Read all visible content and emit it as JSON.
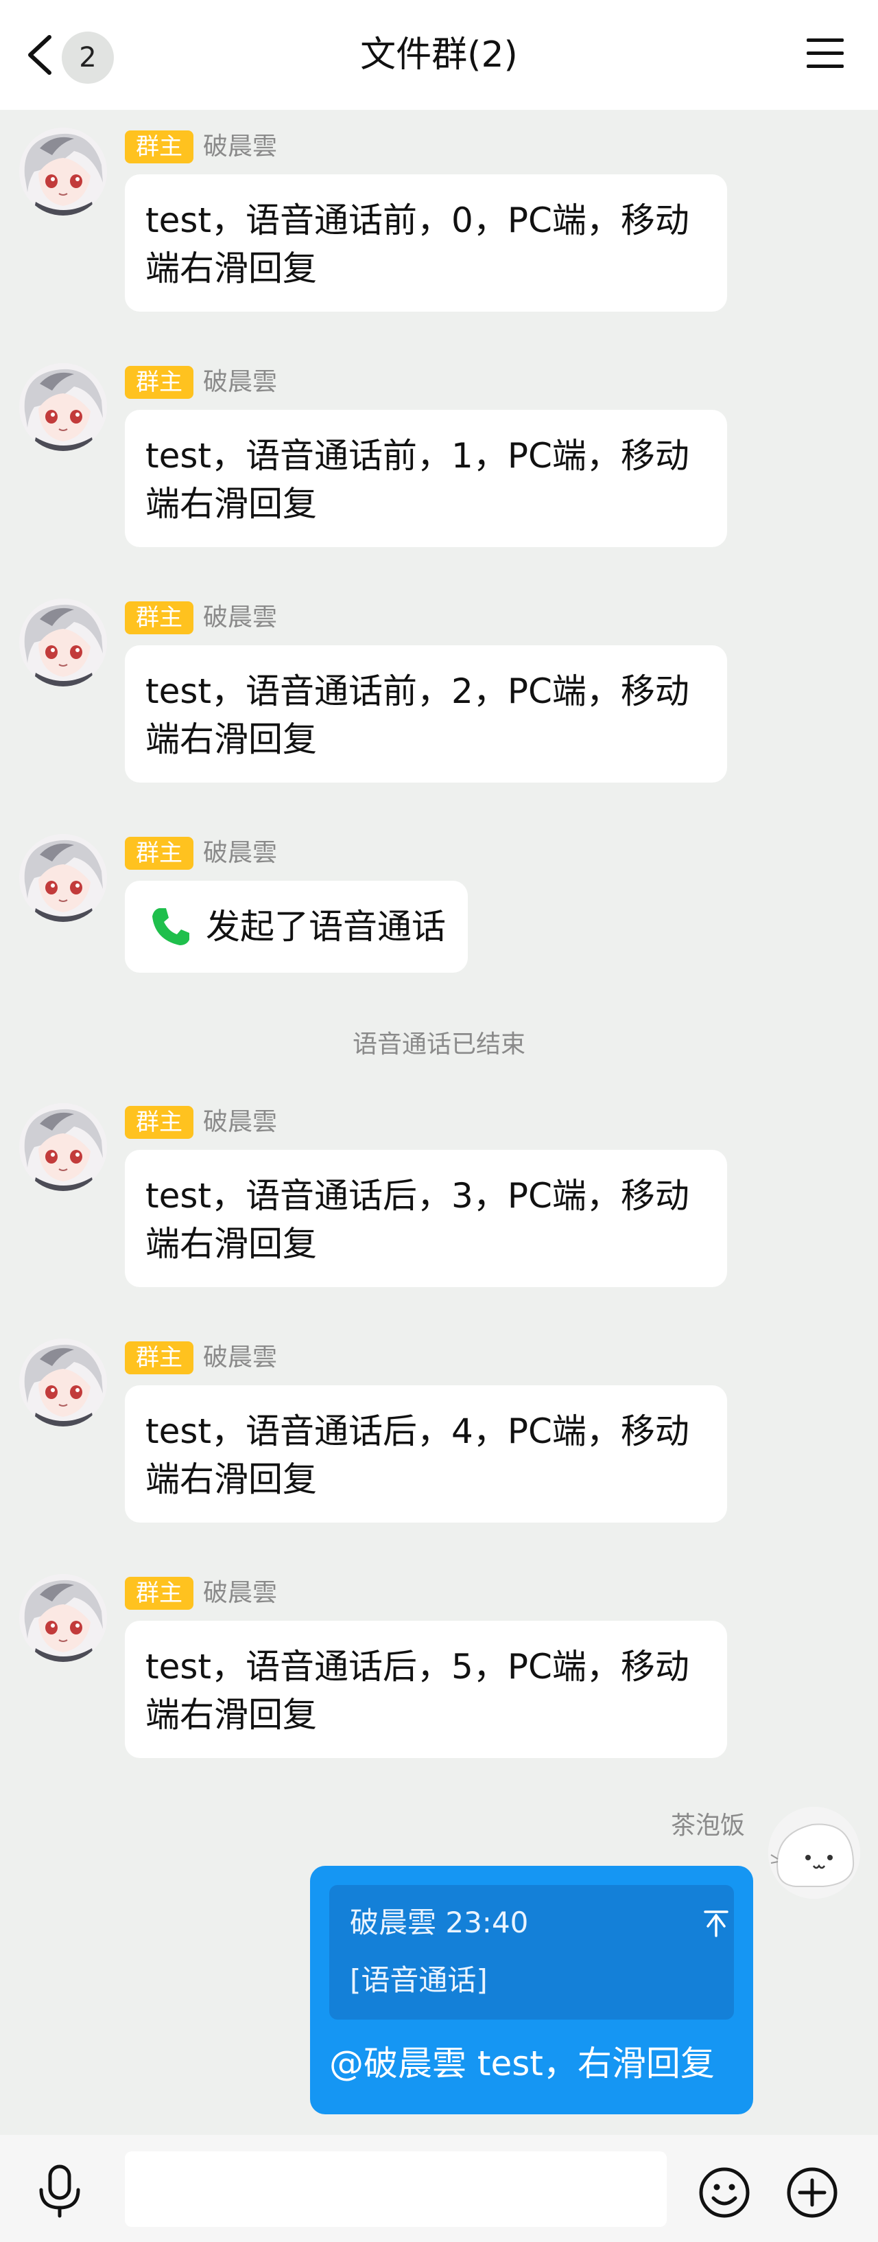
{
  "header": {
    "back_icon": "chevron-left-icon",
    "unread_count": "2",
    "title": "文件群(2)",
    "menu_icon": "hamburger-menu-icon"
  },
  "messages_before_call": [
    {
      "role_tag": "群主",
      "sender": "破晨雲",
      "text": "test，语音通话前，0，PC端，移动端右滑回复"
    },
    {
      "role_tag": "群主",
      "sender": "破晨雲",
      "text": "test，语音通话前，1，PC端，移动端右滑回复"
    },
    {
      "role_tag": "群主",
      "sender": "破晨雲",
      "text": "test，语音通话前，2，PC端，移动端右滑回复"
    }
  ],
  "call_message": {
    "role_tag": "群主",
    "sender": "破晨雲",
    "icon": "phone-icon",
    "text": "发起了语音通话"
  },
  "system_notice": "语音通话已结束",
  "messages_after_call": [
    {
      "role_tag": "群主",
      "sender": "破晨雲",
      "text": "test，语音通话后，3，PC端，移动端右滑回复"
    },
    {
      "role_tag": "群主",
      "sender": "破晨雲",
      "text": "test，语音通话后，4，PC端，移动端右滑回复"
    },
    {
      "role_tag": "群主",
      "sender": "破晨雲",
      "text": "test，语音通话后，5，PC端，移动端右滑回复"
    }
  ],
  "my_message": {
    "sender": "茶泡饭",
    "quote_meta": "破晨雲 23:40",
    "quote_content": "[语音通话]",
    "text": "@破晨雲 test，右滑回复"
  },
  "composer": {
    "mic_icon": "microphone-icon",
    "input_value": "",
    "emoji_icon": "emoji-icon",
    "plus_icon": "plus-circle-icon"
  },
  "colors": {
    "background": "#eef0ee",
    "owner_tag": "#ffc21f",
    "my_bubble": "#1596f3",
    "quote_box": "#1480d8",
    "call_icon": "#1fbf4c"
  }
}
